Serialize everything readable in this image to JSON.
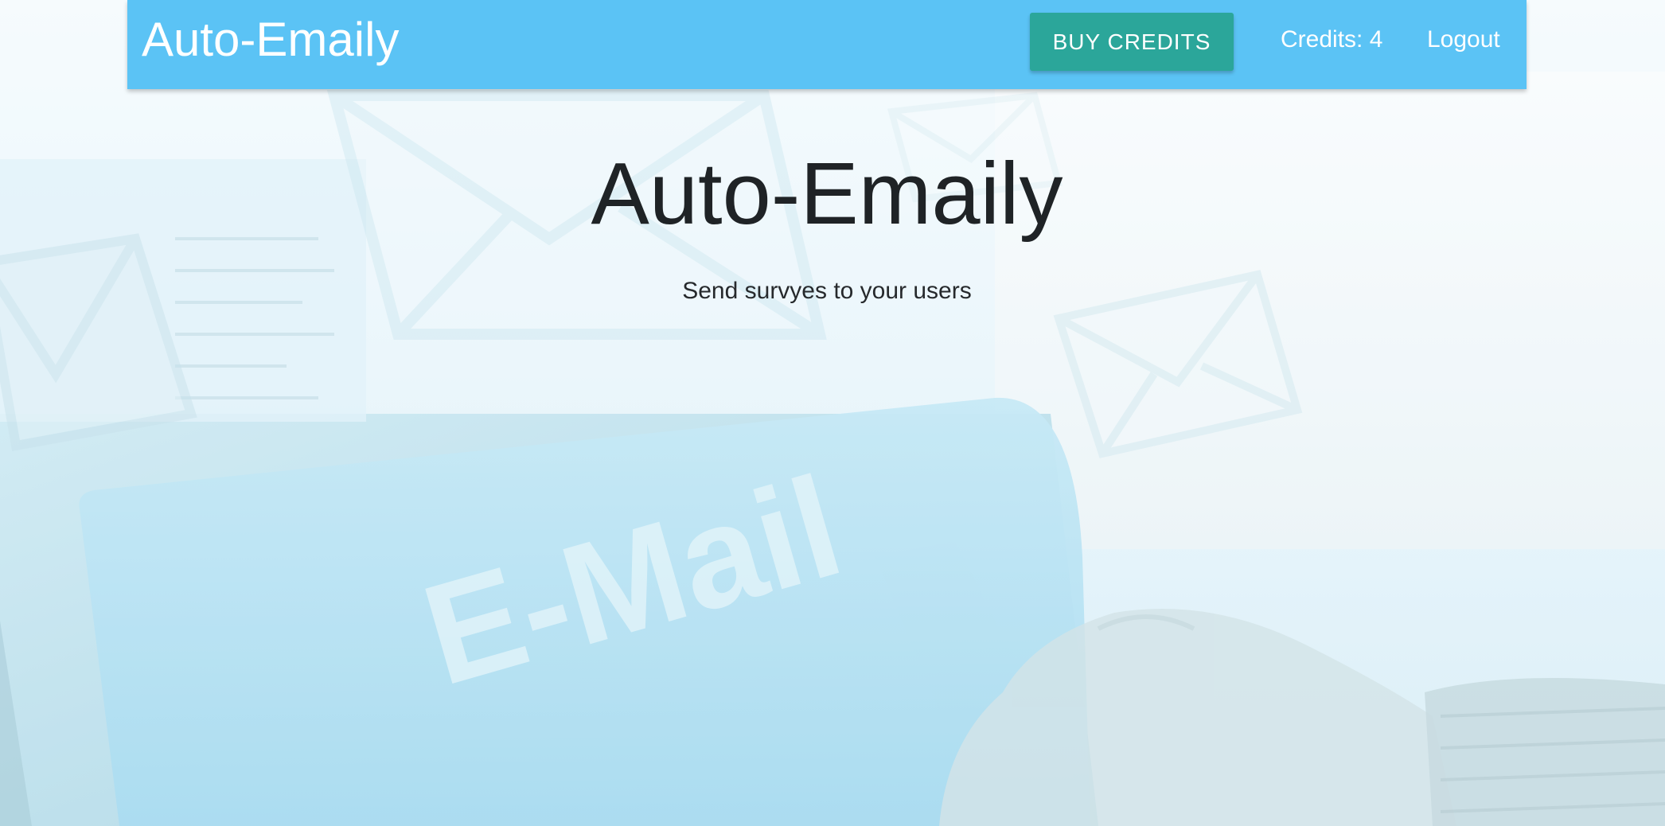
{
  "navbar": {
    "brand": "Auto-Emaily",
    "buy_credits_label": "BUY CREDITS",
    "credits_text": "Credits: 4",
    "logout_label": "Logout"
  },
  "hero": {
    "title": "Auto-Emaily",
    "subtitle": "Send survyes to your users"
  },
  "background": {
    "keyboard_sign_text": "E-Mail"
  },
  "colors": {
    "navbar_bg": "#5bc3f5",
    "button_bg": "#2ba69a",
    "text_dark": "#1f2326",
    "text_light": "#ffffff"
  }
}
